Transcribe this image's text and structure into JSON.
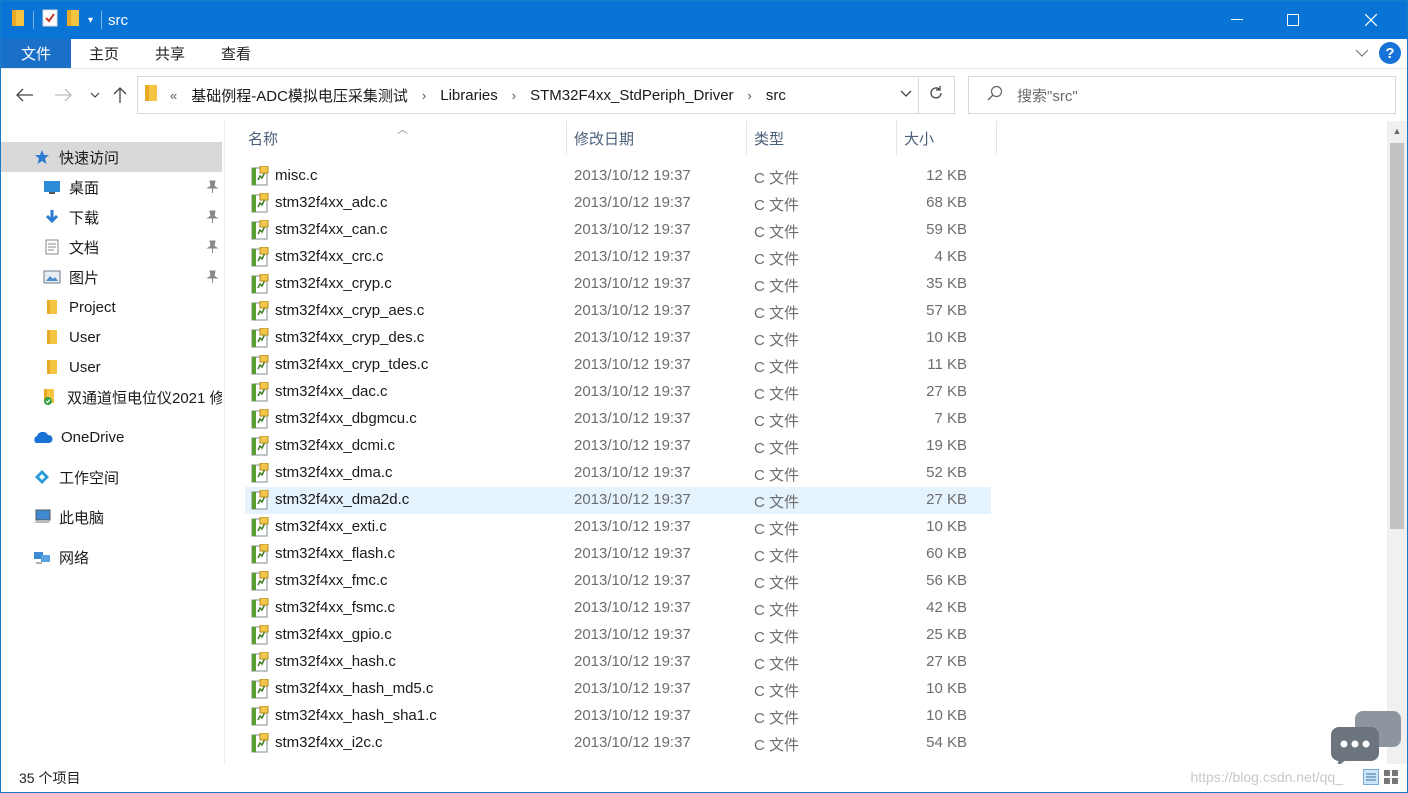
{
  "window": {
    "title": "src",
    "controls": {
      "minimize": "—",
      "maximize": "☐",
      "close": "✕"
    }
  },
  "ribbon": {
    "tabs": [
      "文件",
      "主页",
      "共享",
      "查看"
    ],
    "help": "?"
  },
  "address": {
    "overflow": "«",
    "crumbs": [
      "基础例程-ADC模拟电压采集测试",
      "Libraries",
      "STM32F4xx_StdPeriph_Driver",
      "src"
    ],
    "search_placeholder": "搜索\"src\""
  },
  "sidebar": {
    "items": [
      {
        "label": "快速访问",
        "icon": "star-icon"
      },
      {
        "label": "桌面",
        "icon": "desktop-icon",
        "pinned": true
      },
      {
        "label": "下载",
        "icon": "download-icon",
        "pinned": true
      },
      {
        "label": "文档",
        "icon": "document-icon",
        "pinned": true
      },
      {
        "label": "图片",
        "icon": "pictures-icon",
        "pinned": true
      },
      {
        "label": "Project",
        "icon": "folder-icon"
      },
      {
        "label": "User",
        "icon": "folder-icon"
      },
      {
        "label": "User",
        "icon": "folder-icon"
      },
      {
        "label": "双通道恒电位仪2021 修",
        "icon": "folder-synced-icon"
      },
      {
        "label": "OneDrive",
        "icon": "cloud-icon"
      },
      {
        "label": "工作空间",
        "icon": "workspace-icon"
      },
      {
        "label": "此电脑",
        "icon": "computer-icon"
      },
      {
        "label": "网络",
        "icon": "network-icon"
      }
    ]
  },
  "columns": {
    "name": "名称",
    "date": "修改日期",
    "type": "类型",
    "size": "大小"
  },
  "files": [
    {
      "name": "misc.c",
      "date": "2013/10/12 19:37",
      "type": "C 文件",
      "size": "12 KB"
    },
    {
      "name": "stm32f4xx_adc.c",
      "date": "2013/10/12 19:37",
      "type": "C 文件",
      "size": "68 KB"
    },
    {
      "name": "stm32f4xx_can.c",
      "date": "2013/10/12 19:37",
      "type": "C 文件",
      "size": "59 KB"
    },
    {
      "name": "stm32f4xx_crc.c",
      "date": "2013/10/12 19:37",
      "type": "C 文件",
      "size": "4 KB"
    },
    {
      "name": "stm32f4xx_cryp.c",
      "date": "2013/10/12 19:37",
      "type": "C 文件",
      "size": "35 KB"
    },
    {
      "name": "stm32f4xx_cryp_aes.c",
      "date": "2013/10/12 19:37",
      "type": "C 文件",
      "size": "57 KB"
    },
    {
      "name": "stm32f4xx_cryp_des.c",
      "date": "2013/10/12 19:37",
      "type": "C 文件",
      "size": "10 KB"
    },
    {
      "name": "stm32f4xx_cryp_tdes.c",
      "date": "2013/10/12 19:37",
      "type": "C 文件",
      "size": "11 KB"
    },
    {
      "name": "stm32f4xx_dac.c",
      "date": "2013/10/12 19:37",
      "type": "C 文件",
      "size": "27 KB"
    },
    {
      "name": "stm32f4xx_dbgmcu.c",
      "date": "2013/10/12 19:37",
      "type": "C 文件",
      "size": "7 KB"
    },
    {
      "name": "stm32f4xx_dcmi.c",
      "date": "2013/10/12 19:37",
      "type": "C 文件",
      "size": "19 KB"
    },
    {
      "name": "stm32f4xx_dma.c",
      "date": "2013/10/12 19:37",
      "type": "C 文件",
      "size": "52 KB"
    },
    {
      "name": "stm32f4xx_dma2d.c",
      "date": "2013/10/12 19:37",
      "type": "C 文件",
      "size": "27 KB",
      "hover": true
    },
    {
      "name": "stm32f4xx_exti.c",
      "date": "2013/10/12 19:37",
      "type": "C 文件",
      "size": "10 KB"
    },
    {
      "name": "stm32f4xx_flash.c",
      "date": "2013/10/12 19:37",
      "type": "C 文件",
      "size": "60 KB"
    },
    {
      "name": "stm32f4xx_fmc.c",
      "date": "2013/10/12 19:37",
      "type": "C 文件",
      "size": "56 KB"
    },
    {
      "name": "stm32f4xx_fsmc.c",
      "date": "2013/10/12 19:37",
      "type": "C 文件",
      "size": "42 KB"
    },
    {
      "name": "stm32f4xx_gpio.c",
      "date": "2013/10/12 19:37",
      "type": "C 文件",
      "size": "25 KB"
    },
    {
      "name": "stm32f4xx_hash.c",
      "date": "2013/10/12 19:37",
      "type": "C 文件",
      "size": "27 KB"
    },
    {
      "name": "stm32f4xx_hash_md5.c",
      "date": "2013/10/12 19:37",
      "type": "C 文件",
      "size": "10 KB"
    },
    {
      "name": "stm32f4xx_hash_sha1.c",
      "date": "2013/10/12 19:37",
      "type": "C 文件",
      "size": "10 KB"
    },
    {
      "name": "stm32f4xx_i2c.c",
      "date": "2013/10/12 19:37",
      "type": "C 文件",
      "size": "54 KB"
    }
  ],
  "status": {
    "count": "35 个项目",
    "watermark": "https://blog.csdn.net/qq_"
  },
  "colors": {
    "titlebar": "#0a74d6",
    "file_tab": "#1a6fc7",
    "hover_row": "#e5f3ff",
    "selected_nav": "#d9d9d9"
  }
}
